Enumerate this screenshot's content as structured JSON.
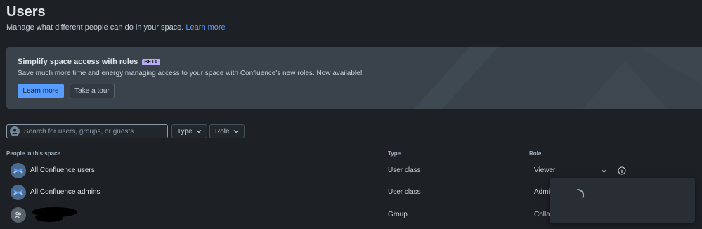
{
  "header": {
    "title": "Users",
    "subtitle": "Manage what different people can do in your space.",
    "learn_more_link": "Learn more"
  },
  "banner": {
    "title": "Simplify space access with roles",
    "badge": "BETA",
    "description": "Save much more time and energy managing access to your space with Confluence's new roles. Now available!",
    "primary_button": "Learn more",
    "secondary_button": "Take a tour"
  },
  "filters": {
    "search_placeholder": "Search for users, groups, or guests",
    "type_label": "Type",
    "role_label": "Role"
  },
  "table": {
    "columns": [
      "People in this space",
      "Type",
      "Role"
    ],
    "rows": [
      {
        "name": "All Confluence users",
        "type": "User class",
        "role": "Viewer",
        "avatar_icon": "confluence-logo-icon"
      },
      {
        "name": "All Confluence admins",
        "type": "User class",
        "role": "Admi",
        "avatar_icon": "confluence-logo-icon"
      },
      {
        "name": "",
        "type": "Group",
        "role": "Colla",
        "avatar_icon": "group-icon"
      }
    ]
  },
  "colors": {
    "background": "#1d2125",
    "accent": "#579dff",
    "banner": "#3a434c",
    "beta_badge": "#b8acf6"
  }
}
